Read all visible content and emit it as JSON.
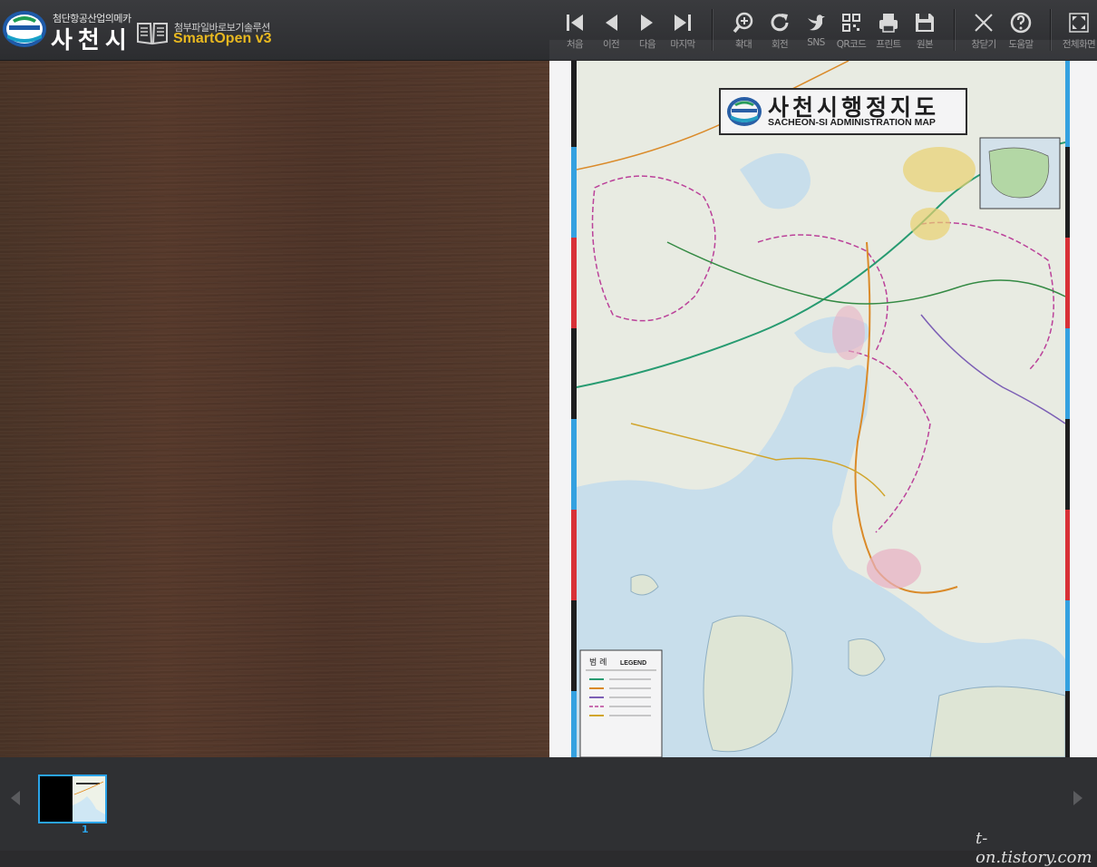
{
  "header": {
    "city_subtitle": "첨단항공산업의메카",
    "city_name": "사천시",
    "brand_subtitle": "첨부파일바로보기솔루션",
    "brand_name": "SmartOpen v3"
  },
  "toolbar": {
    "first": "처음",
    "prev": "이전",
    "next": "다음",
    "last": "마지막",
    "zoom": "확대",
    "rotate": "회전",
    "sns": "SNS",
    "qr": "QR코드",
    "print": "프린트",
    "original": "원본",
    "close": "창닫기",
    "help": "도움말",
    "fullscreen": "전체화면"
  },
  "document": {
    "title_ko": "사천시행정지도",
    "title_en": "SACHEON-SI ADMINISTRATION MAP",
    "legend_ko": "범 례",
    "legend_en": "LEGEND"
  },
  "thumbnails": {
    "page_number": "1"
  },
  "watermark": "t-on.tistory.com",
  "colors": {
    "accent": "#2aa3e8",
    "brand": "#e8b820",
    "sea": "#cfe7f4",
    "land": "#f1f4ea"
  }
}
